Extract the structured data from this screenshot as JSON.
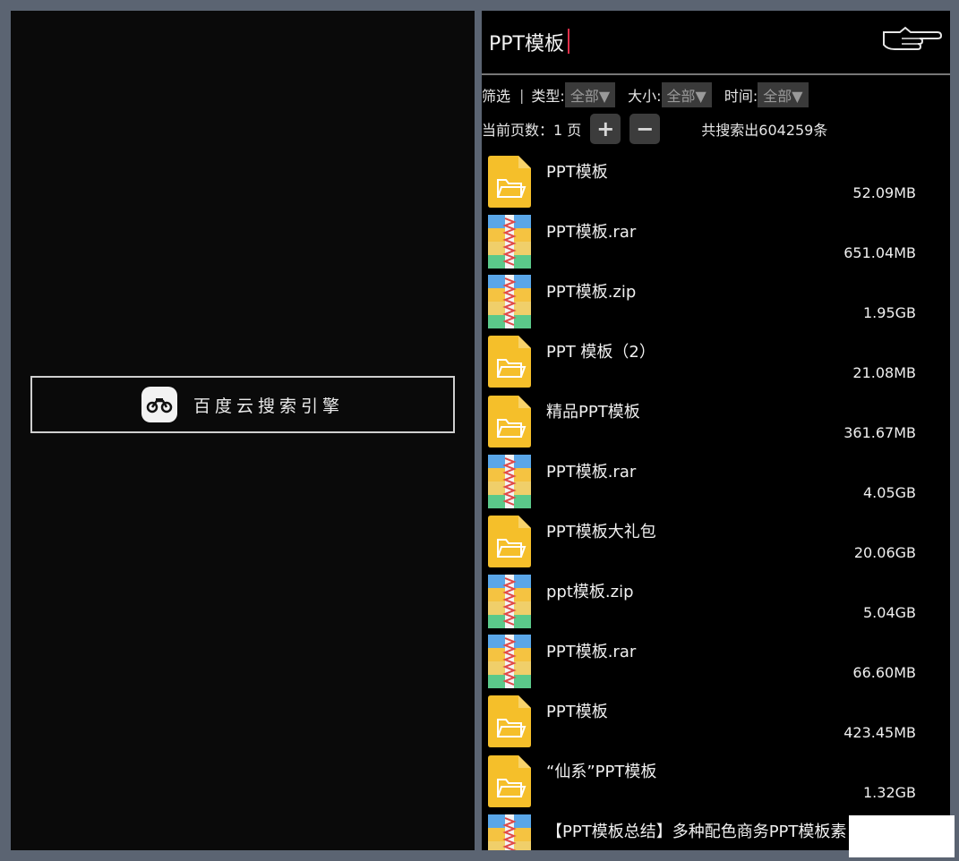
{
  "left": {
    "engine_button": {
      "label": "百度云搜索引擎",
      "icon": "motorcycle-icon"
    }
  },
  "right": {
    "search": {
      "value": "PPT模板"
    },
    "filter": {
      "label": "筛选",
      "separator": "|",
      "type_label": "类型:",
      "type_value": "全部▼",
      "size_label": "大小:",
      "size_value": "全部▼",
      "time_label": "时间:",
      "time_value": "全部▼"
    },
    "paging": {
      "current": "当前页数：1 页",
      "plus": "+",
      "minus": "−",
      "total": "共搜索出604259条"
    },
    "results": [
      {
        "name": "PPT模板",
        "size": "52.09MB",
        "icon": "folder-icon"
      },
      {
        "name": "PPT模板.rar",
        "size": "651.04MB",
        "icon": "archive-icon"
      },
      {
        "name": "PPT模板.zip",
        "size": "1.95GB",
        "icon": "archive-icon"
      },
      {
        "name": "PPT 模板（2）",
        "size": "21.08MB",
        "icon": "folder-icon"
      },
      {
        "name": "精品PPT模板",
        "size": "361.67MB",
        "icon": "folder-icon"
      },
      {
        "name": "PPT模板.rar",
        "size": "4.05GB",
        "icon": "archive-icon"
      },
      {
        "name": "PPT模板大礼包",
        "size": "20.06GB",
        "icon": "folder-icon"
      },
      {
        "name": "ppt模板.zip",
        "size": "5.04GB",
        "icon": "archive-icon"
      },
      {
        "name": "PPT模板.rar",
        "size": "66.60MB",
        "icon": "archive-icon"
      },
      {
        "name": "PPT模板",
        "size": "423.45MB",
        "icon": "folder-icon"
      },
      {
        "name": "“仙系”PPT模板",
        "size": "1.32GB",
        "icon": "folder-icon"
      },
      {
        "name": "【PPT模板总结】多种配色商务PPT模板素 模板设计.rar",
        "size": "",
        "icon": "archive-icon"
      }
    ]
  },
  "colors": {
    "folder": "#f5bf2a",
    "frame": "#5b6472",
    "caret": "#e0304a"
  }
}
